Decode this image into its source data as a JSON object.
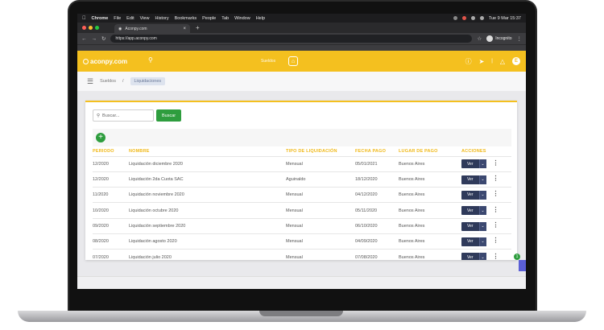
{
  "macos_menu": {
    "items": [
      "Chrome",
      "File",
      "Edit",
      "View",
      "History",
      "Bookmarks",
      "People",
      "Tab",
      "Window",
      "Help"
    ],
    "clock": "Tue 9 Mar  15:37"
  },
  "browser": {
    "tab_title": "Aconpy.com",
    "url": "https://app.aconpy.com",
    "profile_label": "Incognito"
  },
  "app": {
    "logo_text": "aconpy.com",
    "header_section": "Sueldos",
    "avatar_letter": "E",
    "accent": "#f4c01f"
  },
  "breadcrumb": {
    "parent": "Sueldos",
    "current": "Liquidaciones"
  },
  "search": {
    "placeholder": "Buscar...",
    "button_label": "Buscar"
  },
  "table": {
    "headers": [
      "PERIODO",
      "NOMBRE",
      "TIPO DE LIQUIDACIÓN",
      "FECHA PAGO",
      "LUGAR DE PAGO",
      "ACCIONES"
    ],
    "action_label": "Ver",
    "rows": [
      {
        "periodo": "12/2020",
        "nombre": "Liquidación diciembre 2020",
        "tipo": "Mensual",
        "fecha": "05/01/2021",
        "lugar": "Buenos Aires"
      },
      {
        "periodo": "12/2020",
        "nombre": "Liquidación 2da Cuota SAC",
        "tipo": "Aguinaldo",
        "fecha": "18/12/2020",
        "lugar": "Buenos Aires"
      },
      {
        "periodo": "11/2020",
        "nombre": "Liquidación noviembre 2020",
        "tipo": "Mensual",
        "fecha": "04/12/2020",
        "lugar": "Buenos Aires"
      },
      {
        "periodo": "10/2020",
        "nombre": "Liquidación octubre 2020",
        "tipo": "Mensual",
        "fecha": "05/11/2020",
        "lugar": "Buenos Aires"
      },
      {
        "periodo": "09/2020",
        "nombre": "Liquidación septiembre 2020",
        "tipo": "Mensual",
        "fecha": "06/10/2020",
        "lugar": "Buenos Aires"
      },
      {
        "periodo": "08/2020",
        "nombre": "Liquidación agosto 2020",
        "tipo": "Mensual",
        "fecha": "04/09/2020",
        "lugar": "Buenos Aires"
      },
      {
        "periodo": "07/2020",
        "nombre": "Liquidación julio 2020",
        "tipo": "Mensual",
        "fecha": "07/08/2020",
        "lugar": "Buenos Aires"
      }
    ]
  }
}
